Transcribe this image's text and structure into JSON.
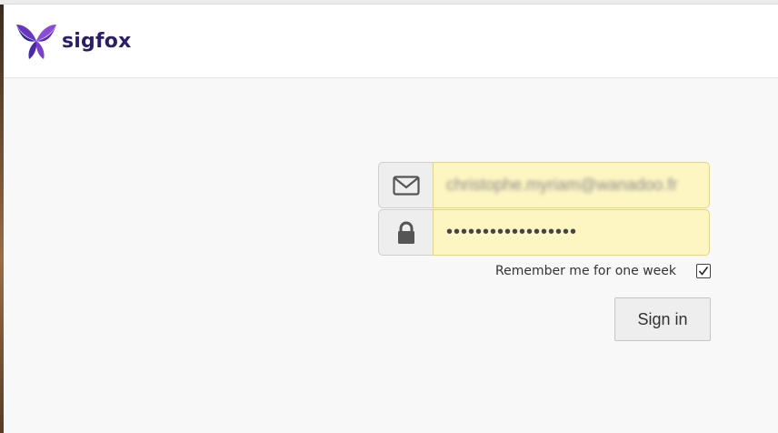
{
  "brand": {
    "name": "sigfox",
    "logo_icon": "butterfly-logo-icon",
    "colors": {
      "text": "#2c1d6b",
      "purple": "#5b2bb3",
      "violet": "#8a4bd6",
      "blue": "#2a2f8f"
    }
  },
  "login_form": {
    "email": {
      "icon": "envelope-icon",
      "value": "christophe.myriam@wanadoo.fr"
    },
    "password": {
      "icon": "lock-icon",
      "value": "••••••••••••••••••"
    },
    "remember_me": {
      "label": "Remember me for one week",
      "checked": true
    },
    "submit_label": "Sign in"
  },
  "colors": {
    "autofill_background": "#fdf5c2",
    "page_background": "#f8f8f8"
  }
}
